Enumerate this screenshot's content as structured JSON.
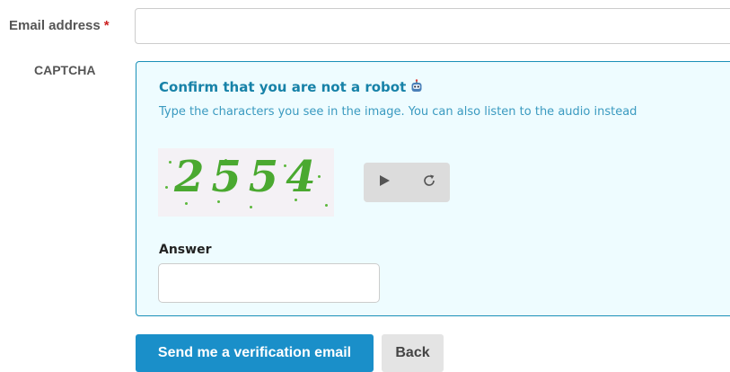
{
  "email": {
    "label": "Email address",
    "required_marker": "*",
    "value": ""
  },
  "captcha": {
    "label": "CAPTCHA",
    "title": "Confirm that you are not a robot",
    "title_icon": "robot-icon",
    "subtitle": "Type the characters you see in the image. You can also listen to the audio instead",
    "image_text": "2554",
    "audio": {
      "play_icon": "play-icon",
      "refresh_icon": "refresh-icon"
    },
    "answer_label": "Answer",
    "answer_value": ""
  },
  "actions": {
    "submit_label": "Send me a verification email",
    "back_label": "Back"
  },
  "colors": {
    "accent": "#1a8fc9",
    "captcha_border": "#1a90b8",
    "captcha_background": "#eefcff",
    "required": "#cc2222"
  }
}
